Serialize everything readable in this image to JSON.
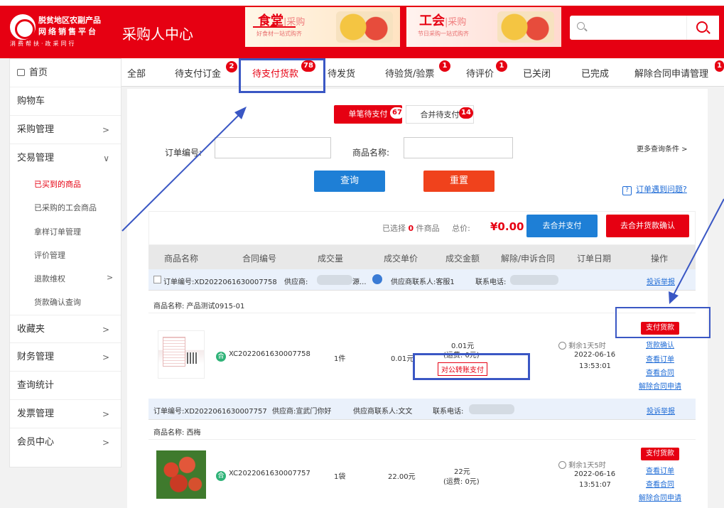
{
  "header": {
    "logo": {
      "line1": "脱贫地区农副产品",
      "line2": "网络销售平台",
      "line3": "消费帮扶·政采同行"
    },
    "center_title": "采购人中心",
    "banners": [
      {
        "title": "食堂",
        "suffix": "|采购",
        "subtitle": "好食材一站式购齐"
      },
      {
        "title": "工会",
        "suffix": "|采购",
        "subtitle": "节日采购一站式购齐"
      }
    ],
    "search": {
      "placeholder": ""
    }
  },
  "sidebar": {
    "home": "首页",
    "items": [
      {
        "label": "购物车",
        "arrow": ""
      },
      {
        "label": "采购管理",
        "arrow": ">"
      },
      {
        "label": "交易管理",
        "arrow": "∨"
      }
    ],
    "sub_items": [
      {
        "label": "已买到的商品",
        "active": true
      },
      {
        "label": "已采购的工会商品"
      },
      {
        "label": "拿样订单管理"
      },
      {
        "label": "评价管理"
      },
      {
        "label": "退款维权",
        "arrow": ">"
      },
      {
        "label": "货款确认查询"
      }
    ],
    "items2": [
      {
        "label": "收藏夹",
        "arrow": ">"
      },
      {
        "label": "财务管理",
        "arrow": ">"
      },
      {
        "label": "查询统计",
        "arrow": ""
      },
      {
        "label": "发票管理",
        "arrow": ">"
      },
      {
        "label": "会员中心",
        "arrow": ">"
      }
    ]
  },
  "tabs": [
    {
      "label": "全部"
    },
    {
      "label": "待支付订金",
      "badge": "2"
    },
    {
      "label": "待支付货款",
      "badge": "78",
      "active": true
    },
    {
      "label": "待发货"
    },
    {
      "label": "待验货/验票",
      "badge": "1"
    },
    {
      "label": "待评价",
      "badge": "1"
    },
    {
      "label": "已关闭"
    },
    {
      "label": "已完成"
    },
    {
      "label": "解除合同申请管理",
      "badge": "1"
    }
  ],
  "segment": {
    "single": "单笔待支付",
    "single_badge": "67",
    "merged": "合并待支付",
    "merged_badge": "14"
  },
  "filters": {
    "order_no_label": "订单编号:",
    "product_name_label": "商品名称:",
    "more": "更多查询条件 >",
    "query_btn": "查询",
    "reset_btn": "重置",
    "help": "订单遇到问题?"
  },
  "summary": {
    "selected_prefix": "已选择",
    "selected_count": "0",
    "selected_suffix": "件商品",
    "total_label": "总价:",
    "total": "¥0.00",
    "merge_pay_btn": "去合并支付",
    "merge_confirm_btn": "去合并货款确认"
  },
  "table_headers": [
    "商品名称",
    "合同编号",
    "成交量",
    "成交单价",
    "成交金额",
    "解除/申诉合同",
    "订单日期",
    "操作"
  ],
  "orders": [
    {
      "order_no": "订单编号:XD2022061630007758",
      "supplier_label": "供应商:",
      "supplier_tail": "源...",
      "contact_label": "供应商联系人:客服1",
      "phone_label": "联系电话:",
      "report": "投诉举报",
      "product_name": "商品名称: 产品测试0915-01",
      "contract_badge": "合",
      "contract_no": "XC2022061630007758",
      "qty": "1件",
      "unit_price": "0.01元",
      "amount": "0.01元",
      "freight": "(运费: 0元)",
      "transfer_tag": "对公转账支付",
      "remaining": "剩余1天5时",
      "date": "2022-06-16",
      "time": "13:53:01",
      "actions": [
        "支付货款",
        "货款确认",
        "查看订单",
        "查看合同",
        "解除合同申请"
      ]
    },
    {
      "order_no": "订单编号:XD2022061630007757",
      "supplier_label": "供应商:宣武门你好",
      "contact_label": "供应商联系人:文文",
      "phone_label": "联系电话:",
      "report": "投诉举报",
      "product_name": "商品名称: 西梅",
      "contract_badge": "合",
      "contract_no": "XC2022061630007757",
      "qty": "1袋",
      "unit_price": "22.00元",
      "amount": "22元",
      "freight": "(运费: 0元)",
      "remaining": "剩余1天5时",
      "date": "2022-06-16",
      "time": "13:51:07",
      "actions": [
        "支付货款",
        "查看订单",
        "查看合同",
        "解除合同申请"
      ]
    }
  ],
  "colors": {
    "brand": "#e60012",
    "link": "#1e6bd6",
    "annotation": "#3a57c4",
    "query": "#1e7fd6"
  }
}
